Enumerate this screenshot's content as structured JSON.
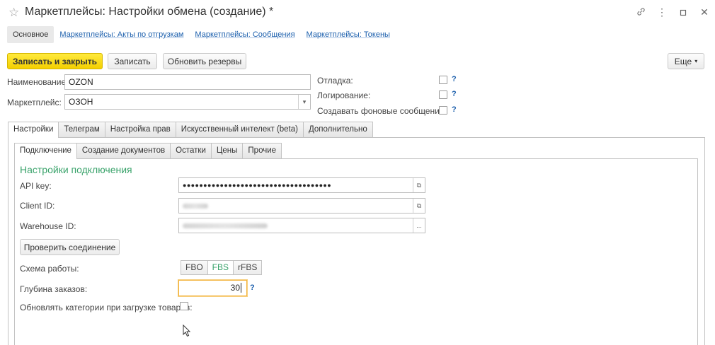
{
  "window": {
    "title": "Маркетплейсы: Настройки обмена (создание) *"
  },
  "nav": {
    "main": "Основное",
    "links": [
      "Маркетплейсы: Акты по отгрузкам",
      "Маркетплейсы: Сообщения",
      "Маркетплейсы: Токены"
    ]
  },
  "toolbar": {
    "save_close": "Записать и закрыть",
    "save": "Записать",
    "refresh": "Обновить резервы",
    "more": "Еще"
  },
  "form": {
    "name_label": "Наименование:",
    "name_value": "OZON",
    "market_label": "Маркетплейс:",
    "market_value": "ОЗОН",
    "debug_label": "Отладка:",
    "logging_label": "Логирование:",
    "bg_messages_label": "Создавать фоновые сообщения:",
    "help": "?"
  },
  "tabs": [
    "Настройки",
    "Телеграм",
    "Настройка прав",
    "Искусственный интелект (beta)",
    "Дополнительно"
  ],
  "subtabs": [
    "Подключение",
    "Создание документов",
    "Остатки",
    "Цены",
    "Прочие"
  ],
  "connection": {
    "section_title": "Настройки подключения",
    "api_key_label": "API key:",
    "api_key_value": "●●●●●●●●●●●●●●●●●●●●●●●●●●●●●●●●●●●●",
    "client_id_label": "Client ID:",
    "warehouse_id_label": "Warehouse ID:",
    "check_button": "Проверить соединение",
    "scheme_label": "Схема работы:",
    "scheme_options": [
      "FBO",
      "FBS",
      "rFBS"
    ],
    "scheme_selected": "FBS",
    "depth_label": "Глубина заказов:",
    "depth_value": "30",
    "update_categories_label": "Обновлять категории при загрузке товаров:"
  },
  "colors": {
    "accent_green": "#3aa36b",
    "link_blue": "#1a5eac",
    "primary_yellow": "#f4cf00",
    "focus_orange": "#f3b33d"
  }
}
